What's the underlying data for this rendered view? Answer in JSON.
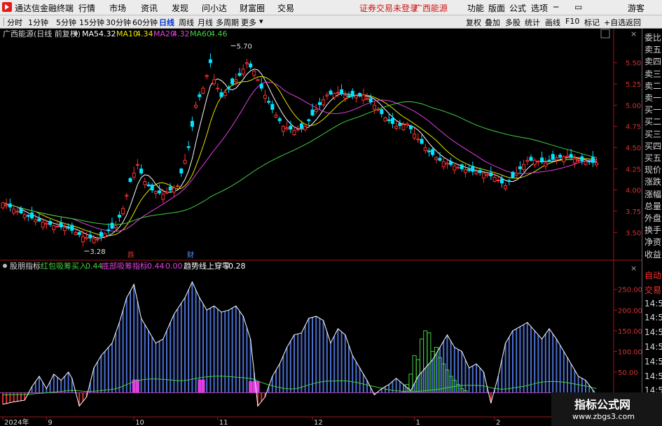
{
  "menubar": {
    "app_title": "通达信金融终端",
    "items": [
      "行情",
      "市场",
      "资讯",
      "发现",
      "问小达",
      "财富圈",
      "交易"
    ],
    "warning": "证券交易未登录",
    "stock": "广西能源",
    "right_items": [
      "功能",
      "版面",
      "公式",
      "选项"
    ],
    "guest": "游客"
  },
  "toolbar": {
    "periods": [
      "分时",
      "1分钟",
      "5分钟",
      "15分钟",
      "30分钟",
      "60分钟",
      "日线",
      "周线",
      "月线",
      "多周期",
      "更多"
    ],
    "active": "日线",
    "right_items": [
      "复权",
      "叠加",
      "多股",
      "统计",
      "画线",
      "F10",
      "标记",
      "+自选",
      "返回"
    ]
  },
  "right_panel": {
    "items": [
      "委比",
      "卖五",
      "卖四",
      "卖三",
      "卖二",
      "卖一",
      "买一",
      "买二",
      "买三",
      "买四",
      "买五",
      "现价",
      "涨跌",
      "涨幅",
      "总量",
      "外盘",
      "换手",
      "净资",
      "收益",
      "自动",
      "交易",
      "14:56",
      "14:56",
      "14:56",
      "14:56",
      "14:56",
      "14:56",
      "14:56"
    ]
  },
  "watermark": {
    "title": "指标公式网",
    "url": "www.zbgs3.com"
  },
  "chart_data": [
    {
      "type": "candlestick",
      "title": "广西能源(日线 前复权)",
      "legend": [
        {
          "name": "MA5",
          "value": "4.32",
          "color": "#ffffff"
        },
        {
          "name": "MA10",
          "value": "4.34",
          "color": "#e6e600"
        },
        {
          "name": "MA20",
          "value": "4.32",
          "color": "#e040e0"
        },
        {
          "name": "MA60",
          "value": "4.46",
          "color": "#40d040"
        }
      ],
      "ylim": [
        3.28,
        5.72
      ],
      "yticks": [
        "5.50",
        "5.25",
        "5.00",
        "4.75",
        "4.50",
        "4.25",
        "4.00",
        "3.75",
        "3.50"
      ],
      "annotations": {
        "high": "5.70",
        "low": "3.28"
      },
      "markers": [
        {
          "text": "跌",
          "color": "#e03030"
        },
        {
          "text": "财",
          "color": "#5b8cff"
        }
      ],
      "up_color": "#ff3030",
      "down_color": "#00e5ff",
      "anchors": [
        [
          0,
          3.85
        ],
        [
          4,
          3.75
        ],
        [
          9,
          3.65
        ],
        [
          14,
          3.58
        ],
        [
          18,
          3.55
        ],
        [
          22,
          3.45
        ],
        [
          26,
          3.42
        ],
        [
          29,
          3.52
        ],
        [
          31,
          3.58
        ],
        [
          33,
          3.78
        ],
        [
          35,
          4.1
        ],
        [
          37,
          4.3
        ],
        [
          39,
          4.1
        ],
        [
          41,
          4.0
        ],
        [
          44,
          3.95
        ],
        [
          48,
          4.05
        ],
        [
          51,
          4.5
        ],
        [
          53,
          5.0
        ],
        [
          55,
          5.2
        ],
        [
          57,
          5.5
        ],
        [
          58,
          5.3
        ],
        [
          60,
          5.1
        ],
        [
          62,
          5.2
        ],
        [
          65,
          5.35
        ],
        [
          67,
          5.5
        ],
        [
          69,
          5.4
        ],
        [
          71,
          5.2
        ],
        [
          74,
          4.95
        ],
        [
          77,
          4.75
        ],
        [
          80,
          4.7
        ],
        [
          83,
          4.75
        ],
        [
          86,
          4.95
        ],
        [
          89,
          5.12
        ],
        [
          92,
          5.15
        ],
        [
          95,
          5.1
        ],
        [
          99,
          5.12
        ],
        [
          102,
          5.0
        ],
        [
          105,
          4.85
        ],
        [
          108,
          4.75
        ],
        [
          111,
          4.78
        ],
        [
          114,
          4.6
        ],
        [
          117,
          4.45
        ],
        [
          120,
          4.35
        ],
        [
          123,
          4.3
        ],
        [
          126,
          4.25
        ],
        [
          129,
          4.22
        ],
        [
          132,
          4.2
        ],
        [
          135,
          4.15
        ],
        [
          138,
          4.05
        ],
        [
          141,
          4.2
        ],
        [
          144,
          4.35
        ],
        [
          146,
          4.35
        ],
        [
          149,
          4.32
        ],
        [
          152,
          4.38
        ],
        [
          155,
          4.4
        ],
        [
          158,
          4.35
        ],
        [
          161,
          4.33
        ],
        [
          163,
          4.32
        ]
      ]
    },
    {
      "type": "bar",
      "title": "股朋指标",
      "legend": [
        {
          "name": "红包吸筹买入",
          "value": "0.44",
          "color": "#40d040"
        },
        {
          "name": "底部吸筹指标",
          "value": "0.44",
          "color": "#e040e0"
        },
        {
          "name": "",
          "value": "0.00",
          "color": "#e040e0"
        },
        {
          "name": "趋势线上穿零",
          "value": "-0.28",
          "color": "#ffffff"
        }
      ],
      "ylim": [
        -55,
        280
      ],
      "yticks": [
        "250.00",
        "200.00",
        "150.00",
        "100.00",
        "50.00"
      ],
      "xticks": [
        {
          "label": "2024年",
          "i": 0
        },
        {
          "label": "9",
          "i": 12
        },
        {
          "label": "10",
          "i": 36
        },
        {
          "label": "11",
          "i": 59
        },
        {
          "label": "12",
          "i": 85
        },
        {
          "label": "1",
          "i": 113
        },
        {
          "label": "2",
          "i": 135
        }
      ],
      "series_anchors": [
        [
          0,
          -28
        ],
        [
          3,
          -22
        ],
        [
          6,
          -18
        ],
        [
          8,
          15
        ],
        [
          10,
          40
        ],
        [
          12,
          10
        ],
        [
          14,
          45
        ],
        [
          16,
          30
        ],
        [
          18,
          50
        ],
        [
          19,
          35
        ],
        [
          21,
          -32
        ],
        [
          23,
          -10
        ],
        [
          25,
          60
        ],
        [
          27,
          90
        ],
        [
          30,
          120
        ],
        [
          32,
          170
        ],
        [
          34,
          230
        ],
        [
          36,
          262
        ],
        [
          38,
          180
        ],
        [
          40,
          150
        ],
        [
          42,
          120
        ],
        [
          44,
          130
        ],
        [
          47,
          190
        ],
        [
          50,
          230
        ],
        [
          52,
          268
        ],
        [
          54,
          230
        ],
        [
          56,
          200
        ],
        [
          58,
          210
        ],
        [
          60,
          195
        ],
        [
          62,
          200
        ],
        [
          64,
          210
        ],
        [
          66,
          185
        ],
        [
          68,
          130
        ],
        [
          70,
          -32
        ],
        [
          72,
          -10
        ],
        [
          74,
          40
        ],
        [
          76,
          70
        ],
        [
          78,
          110
        ],
        [
          80,
          140
        ],
        [
          82,
          145
        ],
        [
          84,
          180
        ],
        [
          86,
          185
        ],
        [
          88,
          175
        ],
        [
          90,
          120
        ],
        [
          92,
          155
        ],
        [
          94,
          140
        ],
        [
          96,
          90
        ],
        [
          98,
          60
        ],
        [
          100,
          30
        ],
        [
          102,
          -5
        ],
        [
          104,
          10
        ],
        [
          106,
          20
        ],
        [
          108,
          35
        ],
        [
          110,
          20
        ],
        [
          112,
          5
        ],
        [
          114,
          40
        ],
        [
          116,
          60
        ],
        [
          118,
          80
        ],
        [
          120,
          110
        ],
        [
          122,
          140
        ],
        [
          124,
          110
        ],
        [
          126,
          100
        ],
        [
          128,
          60
        ],
        [
          130,
          70
        ],
        [
          132,
          50
        ],
        [
          134,
          -25
        ],
        [
          136,
          40
        ],
        [
          138,
          120
        ],
        [
          140,
          150
        ],
        [
          142,
          160
        ],
        [
          144,
          170
        ],
        [
          146,
          150
        ],
        [
          148,
          130
        ],
        [
          150,
          155
        ],
        [
          152,
          130
        ],
        [
          154,
          100
        ],
        [
          156,
          70
        ],
        [
          158,
          40
        ],
        [
          160,
          30
        ],
        [
          163,
          -5
        ]
      ],
      "green_bars": [
        [
          110,
          1
        ],
        [
          111,
          20
        ],
        [
          112,
          45
        ],
        [
          113,
          90
        ],
        [
          114,
          80
        ],
        [
          115,
          130
        ],
        [
          116,
          150
        ],
        [
          117,
          145
        ],
        [
          118,
          100
        ],
        [
          119,
          110
        ],
        [
          120,
          85
        ],
        [
          121,
          70
        ],
        [
          122,
          55
        ],
        [
          123,
          40
        ],
        [
          124,
          30
        ],
        [
          125,
          20
        ],
        [
          126,
          10
        ],
        [
          127,
          5
        ]
      ],
      "magenta_bars": [
        [
          36,
          32
        ],
        [
          37,
          32
        ],
        [
          54,
          32
        ],
        [
          55,
          32
        ],
        [
          68,
          28
        ],
        [
          69,
          28
        ],
        [
          70,
          28
        ]
      ],
      "bar_color": "#4a6ed0",
      "negative_color": "#e03030",
      "line_color": "#ffffff",
      "trend_color": "#40d040",
      "zero_color": "#b040b0"
    }
  ]
}
